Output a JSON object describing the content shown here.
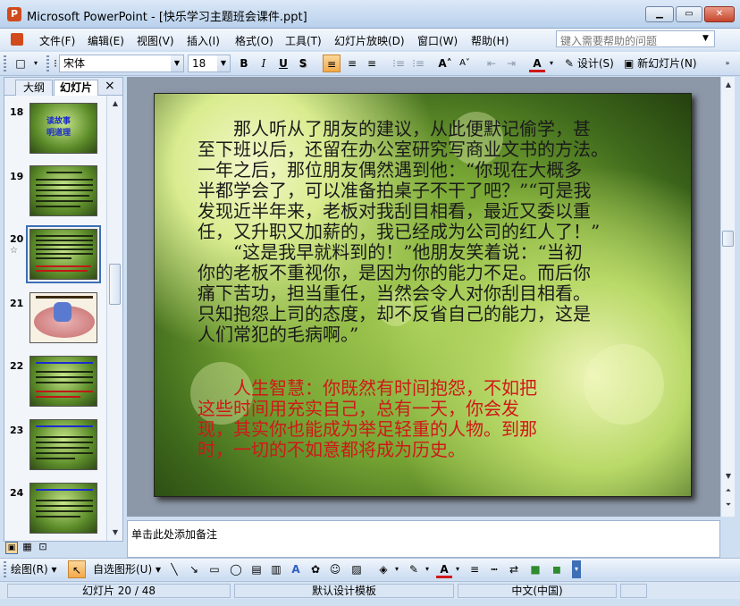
{
  "window": {
    "title": "Microsoft PowerPoint - [快乐学习主题班会课件.ppt]"
  },
  "menu": {
    "items": [
      "文件(F)",
      "编辑(E)",
      "视图(V)",
      "插入(I)",
      "格式(O)",
      "工具(T)",
      "幻灯片放映(D)",
      "窗口(W)",
      "帮助(H)"
    ],
    "help_placeholder": "键入需要帮助的问题"
  },
  "format_toolbar": {
    "font": "宋体",
    "size": "18",
    "bold": "B",
    "italic": "I",
    "underline": "U",
    "shadow": "S",
    "design_label": "设计(S)",
    "new_slide_label": "新幻灯片(N)"
  },
  "panel": {
    "tabs": [
      "大纲",
      "幻灯片"
    ],
    "active_tab": "幻灯片",
    "close": "×"
  },
  "thumbnails": [
    {
      "number": "18",
      "title_line1": "读故事",
      "title_line2": "明道理"
    },
    {
      "number": "19",
      "title_line1": "",
      "title_line2": ""
    },
    {
      "number": "20",
      "title_line1": "",
      "title_line2": "",
      "selected": true
    },
    {
      "number": "21",
      "title_line1": "",
      "title_line2": ""
    },
    {
      "number": "22",
      "title_line1": "",
      "title_line2": ""
    },
    {
      "number": "23",
      "title_line1": "",
      "title_line2": ""
    },
    {
      "number": "24",
      "title_line1": "",
      "title_line2": ""
    }
  ],
  "slide": {
    "para1_lines": [
      "　　那人听从了朋友的建议，从此便默记偷学，甚",
      "至下班以后，还留在办公室研究写商业文书的方法。",
      "一年之后，那位朋友偶然遇到他：“你现在大概多",
      "半都学会了，可以准备拍桌子不干了吧？”“可是我",
      "发现近半年来，老板对我刮目相看，最近又委以重",
      "任，又升职又加薪的，我已经成为公司的红人了！”",
      "　　“这是我早就料到的！”他朋友笑着说：“当初",
      "你的老板不重视你，是因为你的能力不足。而后你",
      "痛下苦功，担当重任，当然会令人对你刮目相看。",
      "只知抱怨上司的态度，却不反省自己的能力，这是",
      "人们常犯的毛病啊。”"
    ],
    "para2_lines": [
      "　　人生智慧：你既然有时间抱怨，不如把",
      "这些时间用充实自己，总有一天，你会发",
      "现，其实你也能成为举足轻重的人物。到那",
      "时，一切的不如意都将成为历史。"
    ],
    "text_color": "#1a1a1a",
    "wisdom_color": "#d01818"
  },
  "notes": {
    "placeholder": "单击此处添加备注"
  },
  "drawing_toolbar": {
    "draw_label": "绘图(R)",
    "autoshape_label": "自选图形(U)"
  },
  "status": {
    "slide_info": "幻灯片 20 / 48",
    "template": "默认设计模板",
    "language": "中文(中国)"
  }
}
